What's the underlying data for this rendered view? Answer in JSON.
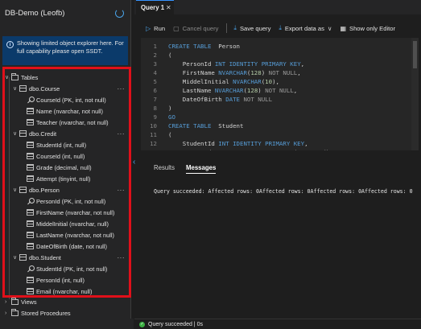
{
  "explorer": {
    "title": "DB-Demo (Leofb)",
    "info": "Showing limited object explorer here. For full capability please open SSDT.",
    "tables_label": "Tables",
    "views_label": "Views",
    "procs_label": "Stored Procedures",
    "more": "···",
    "tables": [
      {
        "name": "dbo.Course",
        "columns": [
          "CourseId (PK, int, not null)",
          "Name (nvarchar, not null)",
          "Teacher (nvarchar, not null)"
        ]
      },
      {
        "name": "dbo.Credit",
        "columns": [
          "StudentId (int, null)",
          "CourseId (int, null)",
          "Grade (decimal, null)",
          "Attempt (tinyint, null)"
        ]
      },
      {
        "name": "dbo.Person",
        "columns": [
          "PersonId (PK, int, not null)",
          "FirstName (nvarchar, not null)",
          "MiddelInitial (nvarchar, null)",
          "LastName (nvarchar, not null)",
          "DateOfBirth (date, not null)"
        ]
      },
      {
        "name": "dbo.Student",
        "columns": [
          "StudentId (PK, int, not null)",
          "PersonId (int, null)",
          "Email (nvarchar, null)"
        ]
      }
    ]
  },
  "tabs": {
    "query_tab": "Query 1",
    "close": "✕"
  },
  "toolbar": {
    "run": "Run",
    "cancel": "Cancel query",
    "save": "Save query",
    "export": "Export data as",
    "show_editor": "Show only Editor"
  },
  "editor": {
    "line_numbers": [
      "1",
      "2",
      "3",
      "4",
      "5",
      "6",
      "7",
      "8",
      "9",
      "10",
      "11",
      "12",
      "13"
    ]
  },
  "results": {
    "tab_results": "Results",
    "tab_messages": "Messages",
    "message": "Query succeeded: Affected rows: 0Affected rows: 0Affected rows: 0Affected rows: 0"
  },
  "status": {
    "text": "Query succeeded | 0s"
  },
  "colors": {
    "accent": "#3794ff",
    "highlight_border": "#e0101a",
    "keyword": "#569cd6",
    "success": "#3cb043"
  }
}
